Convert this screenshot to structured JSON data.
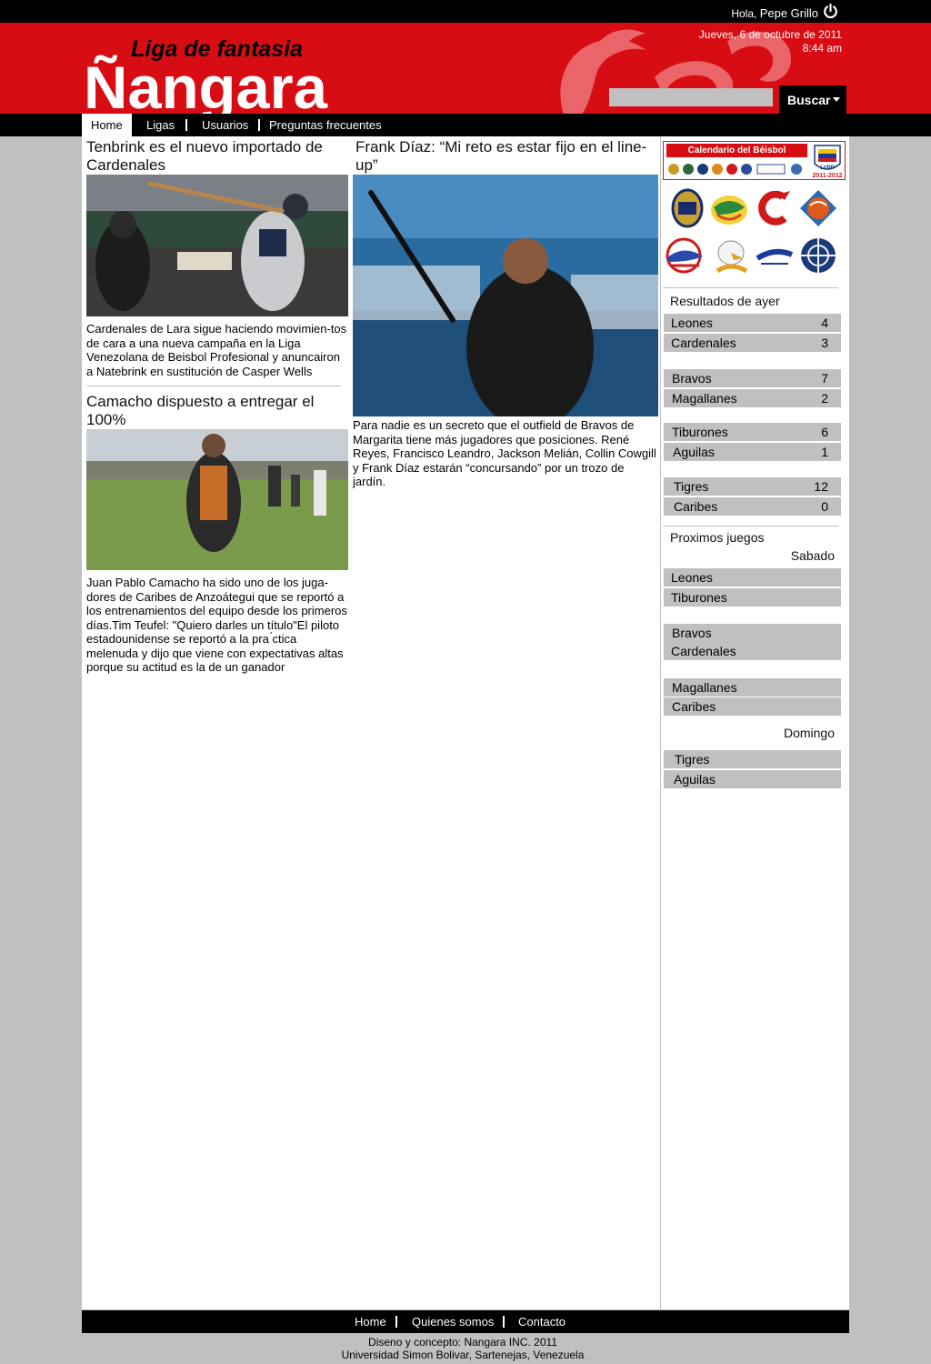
{
  "topbar": {
    "greeting_prefix": "Hola,",
    "user_name": "Pepe Grillo"
  },
  "header": {
    "logo_tagline": "Liga de fantasia",
    "logo_name": "Ñangara",
    "date": "Jueves, 6 de octubre de 2011",
    "time": "8:44 am",
    "search_placeholder": "",
    "search_label": "Buscar"
  },
  "nav": {
    "items": [
      "Home",
      "Ligas",
      "Usuarios",
      "Preguntas frecuentes"
    ]
  },
  "articles": [
    {
      "title": "Tenbrink es el nuevo importado de Cardenales",
      "text": "Cardenales de Lara sigue haciendo movimien-tos de cara a una nueva campaña en la Liga Venezolana de Beisbol Profesional y anuncairon a Natebrink en sustitución de Casper Wells"
    },
    {
      "title": "Camacho dispuesto a entregar el 100%",
      "text": "Juan Pablo Camacho ha sido uno de los juga-dores de Caribes de Anzoátegui que se reportó a los entrenamientos del equipo desde los primeros días.Tim Teufel: \"Quiero darles un título\"El piloto estadounidense se reportó a la pra ́ctica melenuda y dijo que viene con expectativas altas porque su actitud es la de un ganador"
    },
    {
      "title": "Frank Díaz: “Mi reto es estar fijo en el line-up”",
      "text": "Para nadie es un secreto que el outfield de Bravos de Margarita tiene más jugadores que posiciones. René Reyes, Francisco Leandro, Jackson Melián, Collin Cowgill y Frank Díaz estarán “concursando” por un trozo de jardín."
    }
  ],
  "sidebar": {
    "calendar_title": "Calendario del Béisbol Venezolano",
    "calendar_season": "2011-2012",
    "calendar_badge": "LVBP",
    "team_logos": [
      "Leones",
      "Caribes",
      "Cardenales",
      "Tigres",
      "Tiburones",
      "Aguilas",
      "Bravos",
      "Navegantes del Magallanes"
    ],
    "results_heading": "Resultados de ayer",
    "results": [
      {
        "home": "Leones",
        "home_score": "4",
        "away": "Cardenales",
        "away_score": "3"
      },
      {
        "home": "Bravos",
        "home_score": "7",
        "away": "Magallanes",
        "away_score": "2"
      },
      {
        "home": "Tiburones",
        "home_score": "6",
        "away": "Aguilas",
        "away_score": "1"
      },
      {
        "home": "Tigres",
        "home_score": "12",
        "away": "Caribes",
        "away_score": "0"
      }
    ],
    "upcoming_heading": "Proximos juegos",
    "upcoming_days": [
      {
        "day": "Sabado",
        "games": [
          [
            "Leones",
            "Tiburones"
          ],
          [
            "Bravos",
            "Cardenales"
          ],
          [
            "Magallanes",
            "Caribes"
          ]
        ]
      },
      {
        "day": "Domingo",
        "games": [
          [
            "Tigres",
            "Aguilas"
          ]
        ]
      }
    ]
  },
  "footer": {
    "links": [
      "Home",
      "Quienes somos",
      "Contacto"
    ],
    "credit_line1": "Diseno y concepto: Nangara INC. 2011",
    "credit_line2": "Universidad Simon Bolivar, Sartenejas, Venezuela"
  },
  "colors": {
    "brand_red": "#d80d14",
    "bar_black": "#000000",
    "panel_gray": "#c0c0c0"
  }
}
